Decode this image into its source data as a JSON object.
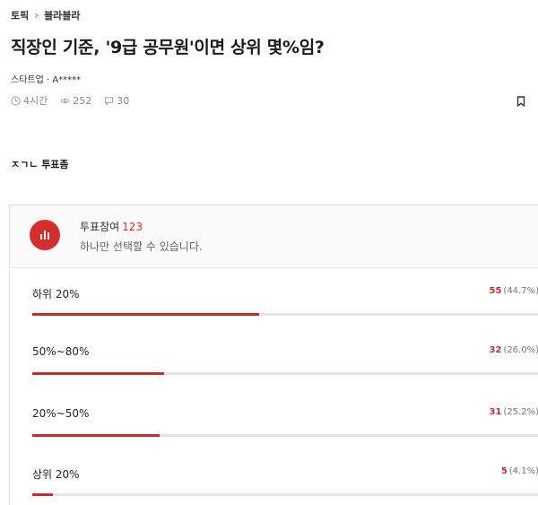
{
  "breadcrumb": {
    "topic": "토픽",
    "board": "블라블라"
  },
  "post": {
    "title": "직장인 기준, '9급 공무원'이면 상위 몇%임?",
    "author": "스타트업 · A*****",
    "time": "4시간",
    "views": "252",
    "comments": "30",
    "body": "ㅈㄱㄴ 투표좀"
  },
  "poll": {
    "label": "투표참여",
    "participants": "123",
    "subtitle": "하나만 선택할 수 있습니다.",
    "accent_color": "#c62c2c",
    "options": [
      {
        "label": "하위 20%",
        "votes": "55",
        "percent_text": "(44.7%)",
        "percent": 44.7
      },
      {
        "label": "50%~80%",
        "votes": "32",
        "percent_text": "(26.0%)",
        "percent": 26.0
      },
      {
        "label": "20%~50%",
        "votes": "31",
        "percent_text": "(25.2%)",
        "percent": 25.2
      },
      {
        "label": "상위 20%",
        "votes": "5",
        "percent_text": "(4.1%)",
        "percent": 4.1
      }
    ]
  },
  "icons": {
    "time": "clock-icon",
    "views": "eye-icon",
    "comments": "comment-icon",
    "bookmark": "bookmark-icon",
    "poll": "bar-chart-icon"
  }
}
